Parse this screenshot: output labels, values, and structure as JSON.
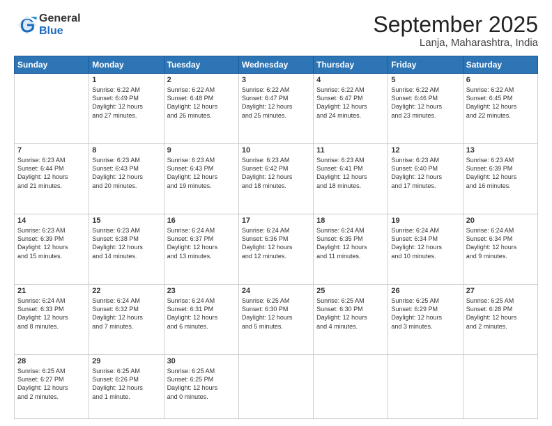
{
  "logo": {
    "general": "General",
    "blue": "Blue"
  },
  "title": "September 2025",
  "location": "Lanja, Maharashtra, India",
  "headers": [
    "Sunday",
    "Monday",
    "Tuesday",
    "Wednesday",
    "Thursday",
    "Friday",
    "Saturday"
  ],
  "weeks": [
    [
      {
        "day": "",
        "sunrise": "",
        "sunset": "",
        "daylight": ""
      },
      {
        "day": "1",
        "sunrise": "6:22 AM",
        "sunset": "6:49 PM",
        "daylight": "12 hours and 27 minutes."
      },
      {
        "day": "2",
        "sunrise": "6:22 AM",
        "sunset": "6:48 PM",
        "daylight": "12 hours and 26 minutes."
      },
      {
        "day": "3",
        "sunrise": "6:22 AM",
        "sunset": "6:47 PM",
        "daylight": "12 hours and 25 minutes."
      },
      {
        "day": "4",
        "sunrise": "6:22 AM",
        "sunset": "6:47 PM",
        "daylight": "12 hours and 24 minutes."
      },
      {
        "day": "5",
        "sunrise": "6:22 AM",
        "sunset": "6:46 PM",
        "daylight": "12 hours and 23 minutes."
      },
      {
        "day": "6",
        "sunrise": "6:22 AM",
        "sunset": "6:45 PM",
        "daylight": "12 hours and 22 minutes."
      }
    ],
    [
      {
        "day": "7",
        "sunrise": "6:23 AM",
        "sunset": "6:44 PM",
        "daylight": "12 hours and 21 minutes."
      },
      {
        "day": "8",
        "sunrise": "6:23 AM",
        "sunset": "6:43 PM",
        "daylight": "12 hours and 20 minutes."
      },
      {
        "day": "9",
        "sunrise": "6:23 AM",
        "sunset": "6:43 PM",
        "daylight": "12 hours and 19 minutes."
      },
      {
        "day": "10",
        "sunrise": "6:23 AM",
        "sunset": "6:42 PM",
        "daylight": "12 hours and 18 minutes."
      },
      {
        "day": "11",
        "sunrise": "6:23 AM",
        "sunset": "6:41 PM",
        "daylight": "12 hours and 18 minutes."
      },
      {
        "day": "12",
        "sunrise": "6:23 AM",
        "sunset": "6:40 PM",
        "daylight": "12 hours and 17 minutes."
      },
      {
        "day": "13",
        "sunrise": "6:23 AM",
        "sunset": "6:39 PM",
        "daylight": "12 hours and 16 minutes."
      }
    ],
    [
      {
        "day": "14",
        "sunrise": "6:23 AM",
        "sunset": "6:39 PM",
        "daylight": "12 hours and 15 minutes."
      },
      {
        "day": "15",
        "sunrise": "6:23 AM",
        "sunset": "6:38 PM",
        "daylight": "12 hours and 14 minutes."
      },
      {
        "day": "16",
        "sunrise": "6:24 AM",
        "sunset": "6:37 PM",
        "daylight": "12 hours and 13 minutes."
      },
      {
        "day": "17",
        "sunrise": "6:24 AM",
        "sunset": "6:36 PM",
        "daylight": "12 hours and 12 minutes."
      },
      {
        "day": "18",
        "sunrise": "6:24 AM",
        "sunset": "6:35 PM",
        "daylight": "12 hours and 11 minutes."
      },
      {
        "day": "19",
        "sunrise": "6:24 AM",
        "sunset": "6:34 PM",
        "daylight": "12 hours and 10 minutes."
      },
      {
        "day": "20",
        "sunrise": "6:24 AM",
        "sunset": "6:34 PM",
        "daylight": "12 hours and 9 minutes."
      }
    ],
    [
      {
        "day": "21",
        "sunrise": "6:24 AM",
        "sunset": "6:33 PM",
        "daylight": "12 hours and 8 minutes."
      },
      {
        "day": "22",
        "sunrise": "6:24 AM",
        "sunset": "6:32 PM",
        "daylight": "12 hours and 7 minutes."
      },
      {
        "day": "23",
        "sunrise": "6:24 AM",
        "sunset": "6:31 PM",
        "daylight": "12 hours and 6 minutes."
      },
      {
        "day": "24",
        "sunrise": "6:25 AM",
        "sunset": "6:30 PM",
        "daylight": "12 hours and 5 minutes."
      },
      {
        "day": "25",
        "sunrise": "6:25 AM",
        "sunset": "6:30 PM",
        "daylight": "12 hours and 4 minutes."
      },
      {
        "day": "26",
        "sunrise": "6:25 AM",
        "sunset": "6:29 PM",
        "daylight": "12 hours and 3 minutes."
      },
      {
        "day": "27",
        "sunrise": "6:25 AM",
        "sunset": "6:28 PM",
        "daylight": "12 hours and 2 minutes."
      }
    ],
    [
      {
        "day": "28",
        "sunrise": "6:25 AM",
        "sunset": "6:27 PM",
        "daylight": "12 hours and 2 minutes."
      },
      {
        "day": "29",
        "sunrise": "6:25 AM",
        "sunset": "6:26 PM",
        "daylight": "12 hours and 1 minute."
      },
      {
        "day": "30",
        "sunrise": "6:25 AM",
        "sunset": "6:25 PM",
        "daylight": "12 hours and 0 minutes."
      },
      {
        "day": "",
        "sunrise": "",
        "sunset": "",
        "daylight": ""
      },
      {
        "day": "",
        "sunrise": "",
        "sunset": "",
        "daylight": ""
      },
      {
        "day": "",
        "sunrise": "",
        "sunset": "",
        "daylight": ""
      },
      {
        "day": "",
        "sunrise": "",
        "sunset": "",
        "daylight": ""
      }
    ]
  ]
}
